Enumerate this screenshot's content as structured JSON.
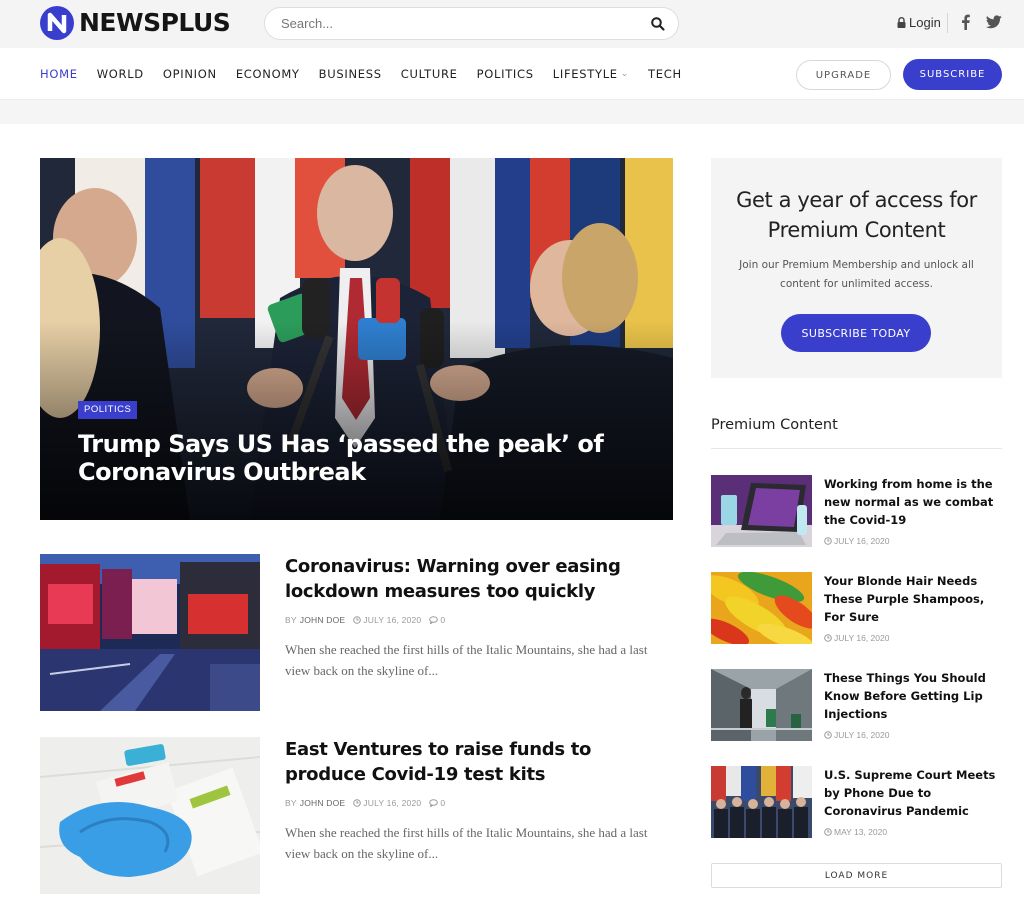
{
  "brand": {
    "name": "NEWSPLUS",
    "accent": "#3a3ecc"
  },
  "header": {
    "search_placeholder": "Search...",
    "login_label": "Login",
    "social": [
      "facebook-icon",
      "twitter-icon"
    ]
  },
  "nav": {
    "items": [
      {
        "label": "HOME",
        "active": true
      },
      {
        "label": "WORLD"
      },
      {
        "label": "OPINION"
      },
      {
        "label": "ECONOMY"
      },
      {
        "label": "BUSINESS"
      },
      {
        "label": "CULTURE"
      },
      {
        "label": "POLITICS"
      },
      {
        "label": "LIFESTYLE",
        "has_dropdown": true
      },
      {
        "label": "TECH"
      }
    ],
    "upgrade_label": "UPGRADE",
    "subscribe_label": "SUBSCRIBE"
  },
  "hero": {
    "category": "POLITICS",
    "title": "Trump Says US Has ‘passed the peak’ of Coronavirus Outbreak"
  },
  "articles": [
    {
      "title": "Coronavirus: Warning over easing lockdown measures too quickly",
      "by": "BY",
      "author": "JOHN DOE",
      "date": "JULY 16, 2020",
      "comments": "0",
      "excerpt": "When she reached the first hills of the Italic Mountains, she had a last view back on the skyline of..."
    },
    {
      "title": "East Ventures to raise funds to produce Covid-19 test kits",
      "by": "BY",
      "author": "JOHN DOE",
      "date": "JULY 16, 2020",
      "comments": "0",
      "excerpt": "When she reached the first hills of the Italic Mountains, she had a last view back on the skyline of..."
    }
  ],
  "sidebar": {
    "promo": {
      "title": "Get a year of access for Premium Content",
      "text": "Join our Premium Membership and unlock all content for unlimited access.",
      "button": "SUBSCRIBE TODAY"
    },
    "heading": "Premium Content",
    "items": [
      {
        "title": "Working from home is the new normal as we combat the Covid-19",
        "date": "JULY 16, 2020"
      },
      {
        "title": "Your Blonde Hair Needs These Purple Shampoos, For Sure",
        "date": "JULY 16, 2020"
      },
      {
        "title": "These Things You Should Know Before Getting Lip Injections",
        "date": "JULY 16, 2020"
      },
      {
        "title": "U.S. Supreme Court Meets by Phone Due to Coronavirus Pandemic",
        "date": "MAY 13, 2020"
      }
    ],
    "load_more": "LOAD MORE"
  }
}
